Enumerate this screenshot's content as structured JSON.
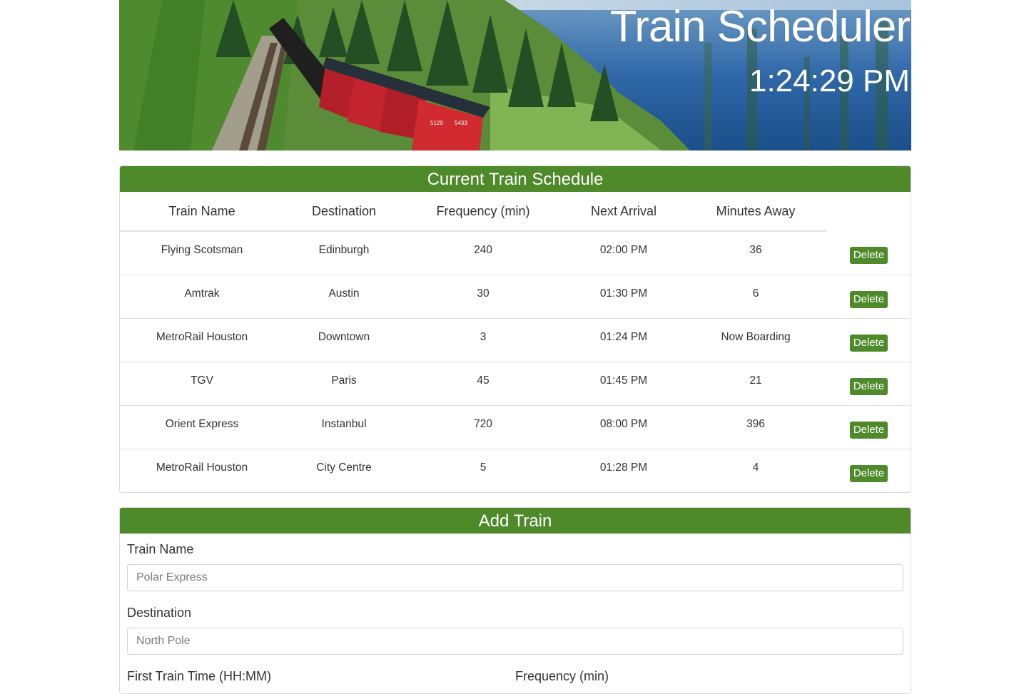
{
  "banner": {
    "title": "Train Scheduler",
    "clock": "1:24:29 PM",
    "train_number_1": "5129",
    "train_number_2": "5433"
  },
  "schedule": {
    "header": "Current Train Schedule",
    "columns": [
      "Train Name",
      "Destination",
      "Frequency (min)",
      "Next Arrival",
      "Minutes Away"
    ],
    "delete_label": "Delete",
    "rows": [
      {
        "name": "Flying Scotsman",
        "destination": "Edinburgh",
        "frequency": "240",
        "next_arrival": "02:00 PM",
        "minutes_away": "36"
      },
      {
        "name": "Amtrak",
        "destination": "Austin",
        "frequency": "30",
        "next_arrival": "01:30 PM",
        "minutes_away": "6"
      },
      {
        "name": "MetroRail Houston",
        "destination": "Downtown",
        "frequency": "3",
        "next_arrival": "01:24 PM",
        "minutes_away": "Now Boarding"
      },
      {
        "name": "TGV",
        "destination": "Paris",
        "frequency": "45",
        "next_arrival": "01:45 PM",
        "minutes_away": "21"
      },
      {
        "name": "Orient Express",
        "destination": "Instanbul",
        "frequency": "720",
        "next_arrival": "08:00 PM",
        "minutes_away": "396"
      },
      {
        "name": "MetroRail Houston",
        "destination": "City Centre",
        "frequency": "5",
        "next_arrival": "01:28 PM",
        "minutes_away": "4"
      }
    ]
  },
  "add_train": {
    "header": "Add Train",
    "train_name_label": "Train Name",
    "train_name_placeholder": "Polar Express",
    "destination_label": "Destination",
    "destination_placeholder": "North Pole",
    "first_time_label": "First Train Time (HH:MM)",
    "frequency_label": "Frequency (min)"
  },
  "colors": {
    "accent": "#4e8a2a",
    "card_border": "#dcdcdc"
  }
}
